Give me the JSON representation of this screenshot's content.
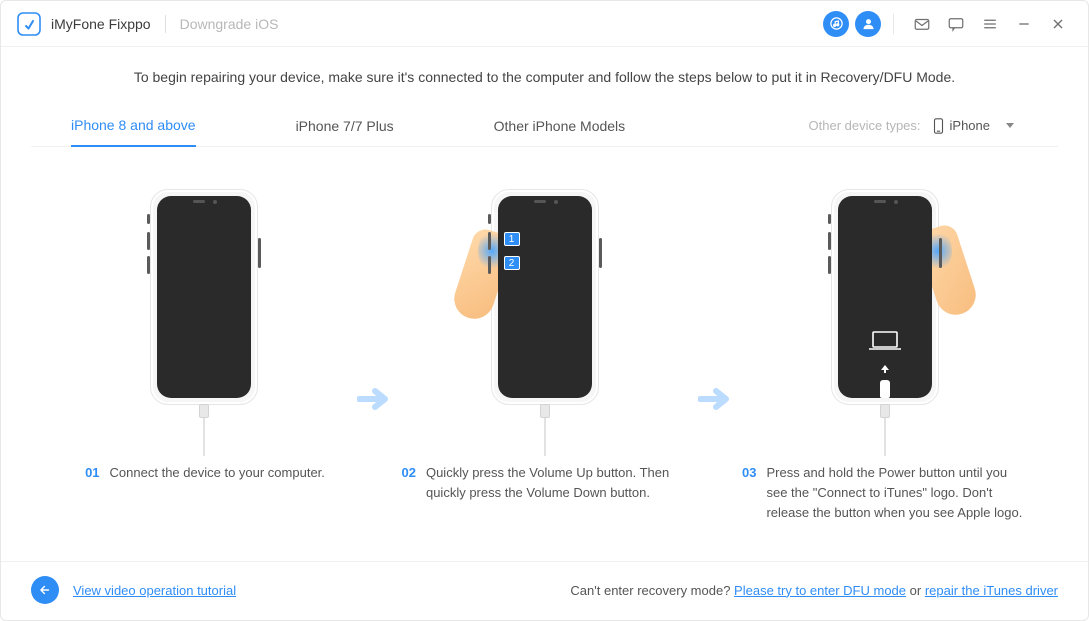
{
  "app": {
    "title": "iMyFone Fixppo",
    "breadcrumb": "Downgrade iOS"
  },
  "intro": "To begin repairing your device, make sure it's connected to the computer and follow the steps below to put it in Recovery/DFU Mode.",
  "tabs": {
    "t1": "iPhone 8 and above",
    "t2": "iPhone 7/7 Plus",
    "t3": "Other iPhone Models",
    "other_label": "Other device types:",
    "device_select": "iPhone"
  },
  "steps": {
    "s1": {
      "num": "01",
      "text": "Connect the device to your computer."
    },
    "s2": {
      "num": "02",
      "text": "Quickly press the Volume Up button. Then quickly press the Volume Down button.",
      "badge1": "1",
      "badge2": "2"
    },
    "s3": {
      "num": "03",
      "text": "Press and hold the Power button until you see the \"Connect to iTunes\" logo. Don't release the button when you see Apple logo."
    }
  },
  "footer": {
    "tutorial_link": "View video operation tutorial",
    "cant_enter": "Can't enter recovery mode? ",
    "dfu_link": "Please try to enter DFU mode",
    "or": " or ",
    "repair_link": "repair the iTunes driver"
  }
}
